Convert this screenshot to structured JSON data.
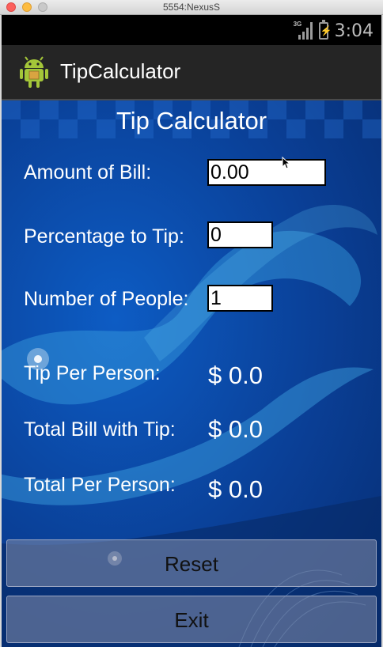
{
  "window": {
    "title": "5554:NexusS"
  },
  "statusbar": {
    "network": "3G",
    "time": "3:04"
  },
  "actionbar": {
    "app_title": "TipCalculator",
    "icon": "android-robot-icon"
  },
  "form": {
    "heading": "Tip Calculator",
    "bill": {
      "label": "Amount of Bill:",
      "value": "0.00"
    },
    "tip_percent": {
      "label": "Percentage to Tip:",
      "value": "0"
    },
    "people": {
      "label": "Number of People:",
      "value": "1"
    }
  },
  "results": {
    "tip_per_person": {
      "label": "Tip Per Person:",
      "value": "$ 0.0"
    },
    "total_with_tip": {
      "label": "Total Bill with Tip:",
      "value": "$ 0.0"
    },
    "total_per_person": {
      "label": "Total Per Person:",
      "value": "$ 0.0"
    }
  },
  "buttons": {
    "reset": "Reset",
    "exit": "Exit"
  },
  "colors": {
    "background": "#0a3f96",
    "actionbar": "#252525",
    "button": "#858eaa"
  }
}
